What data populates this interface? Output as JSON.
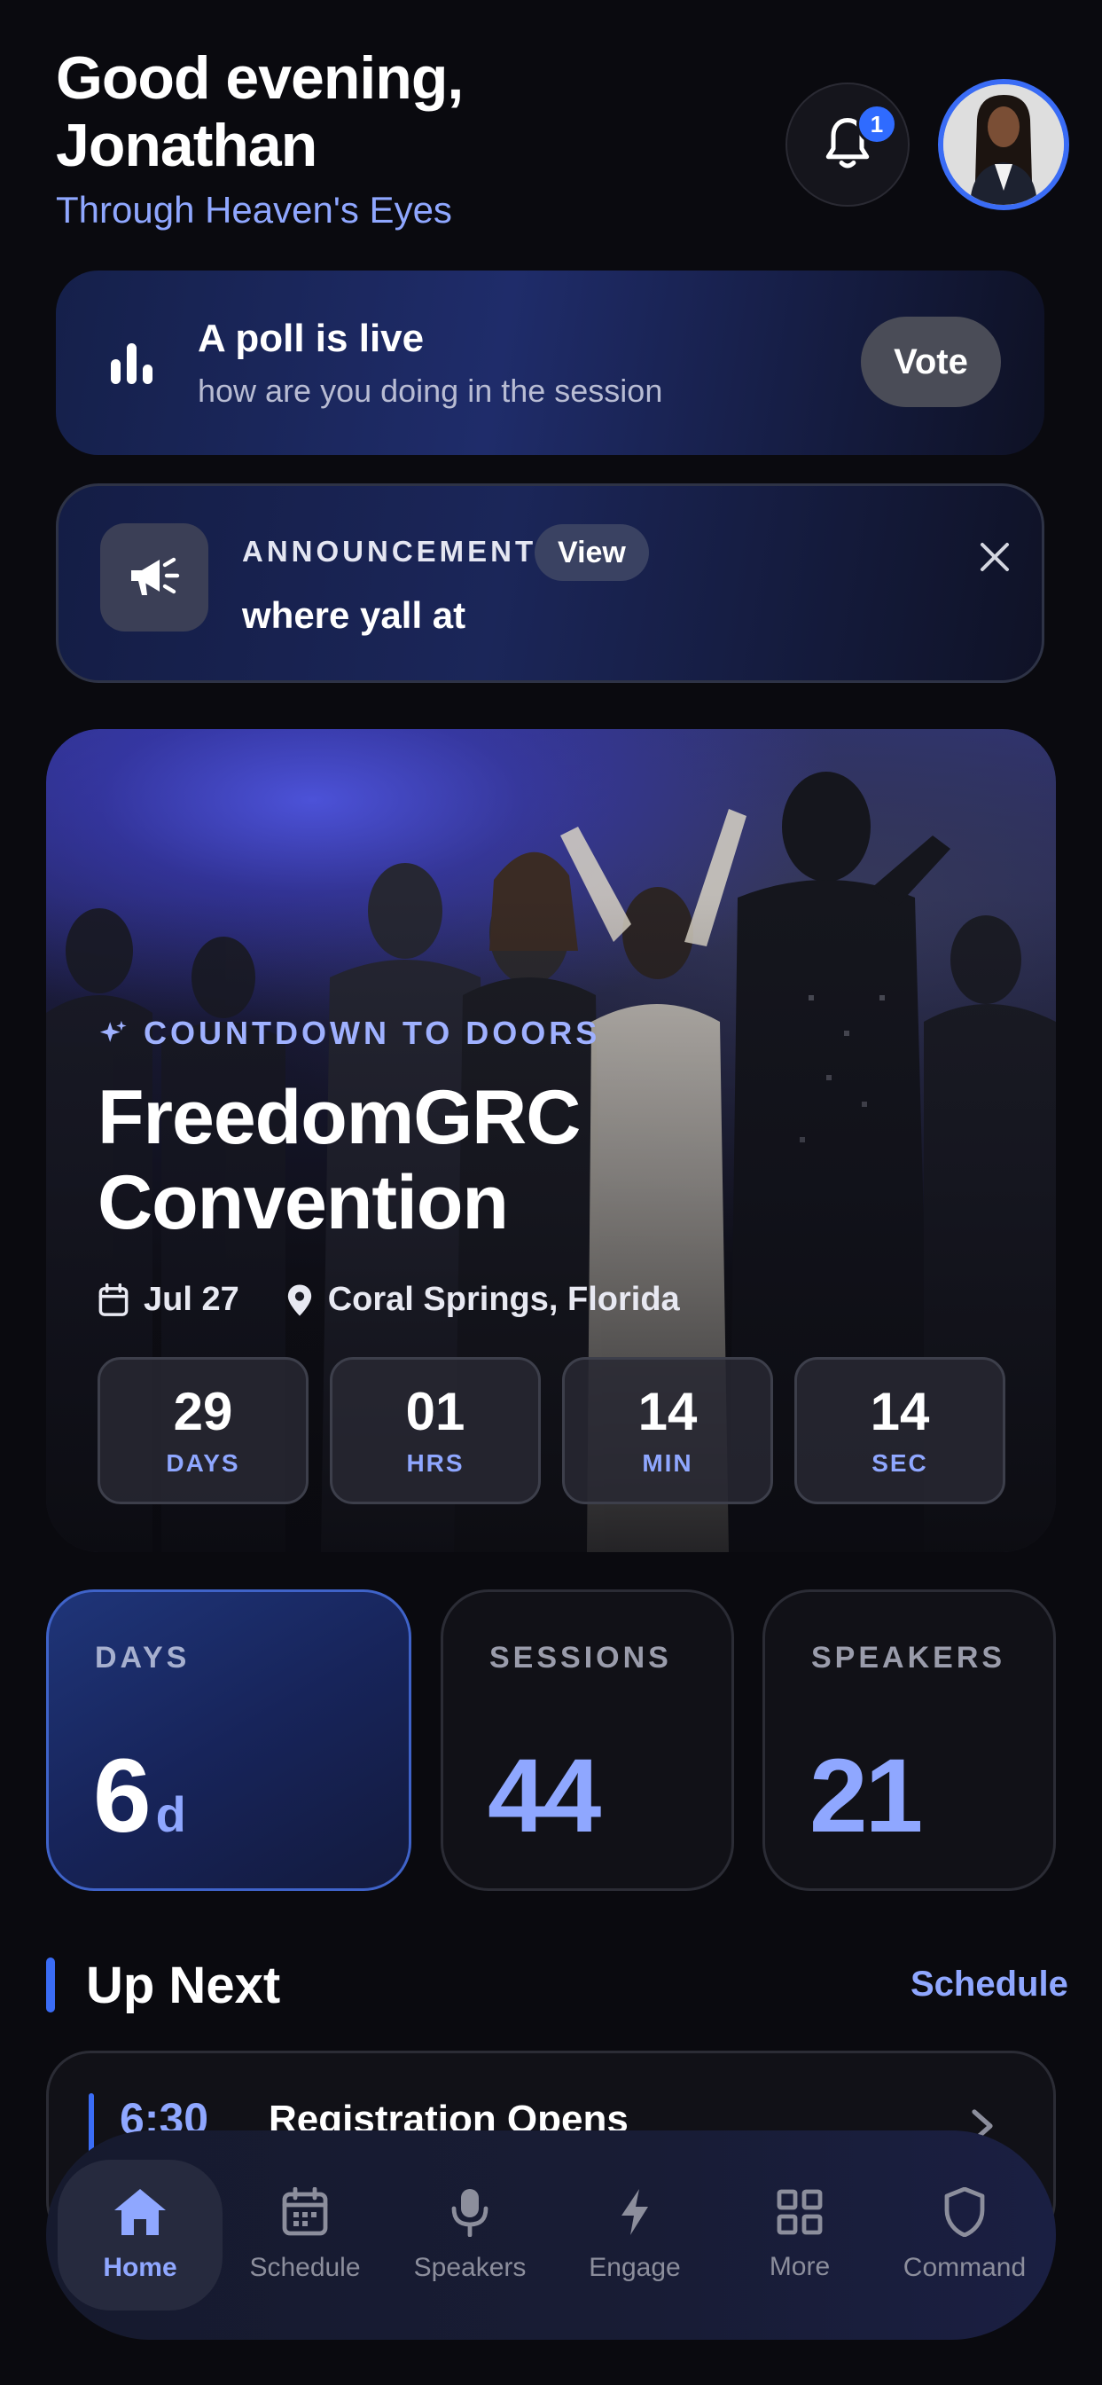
{
  "header": {
    "greeting": "Good evening, Jonathan",
    "subtitle": "Through Heaven's Eyes",
    "notification_count": "1"
  },
  "poll": {
    "title": "A poll is live",
    "subtitle": "how are you doing in the session",
    "button": "Vote"
  },
  "announcement": {
    "label": "ANNOUNCEMENT",
    "view_button": "View",
    "text": "where yall at"
  },
  "hero": {
    "eyebrow": "COUNTDOWN TO DOORS",
    "title": "FreedomGRC Convention",
    "date": "Jul 27",
    "location": "Coral Springs, Florida",
    "countdown": [
      {
        "value": "29",
        "unit": "DAYS"
      },
      {
        "value": "01",
        "unit": "HRS"
      },
      {
        "value": "14",
        "unit": "MIN"
      },
      {
        "value": "14",
        "unit": "SEC"
      }
    ]
  },
  "stats": [
    {
      "label": "DAYS",
      "value": "6",
      "unit": "d"
    },
    {
      "label": "SESSIONS",
      "value": "44"
    },
    {
      "label": "SPEAKERS",
      "value": "21"
    }
  ],
  "up_next": {
    "title": "Up Next",
    "link": "Schedule",
    "session": {
      "time": "6:30",
      "title": "Registration Opens"
    }
  },
  "nav": [
    {
      "label": "Home",
      "icon": "home-icon",
      "active": true
    },
    {
      "label": "Schedule",
      "icon": "calendar-icon"
    },
    {
      "label": "Speakers",
      "icon": "microphone-icon"
    },
    {
      "label": "Engage",
      "icon": "lightning-icon"
    },
    {
      "label": "More",
      "icon": "grid-icon"
    },
    {
      "label": "Command",
      "icon": "shield-icon"
    }
  ],
  "colors": {
    "accent": "#8fa7ff",
    "primary": "#3a6cf5",
    "background": "#0a0a0f"
  }
}
